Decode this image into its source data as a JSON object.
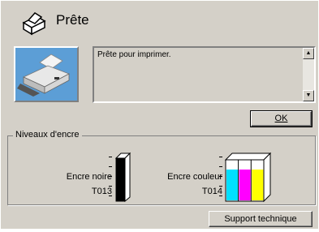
{
  "header": {
    "status_title": "Prête",
    "icon": "printer-status-icon"
  },
  "status": {
    "message": "Prête pour imprimer."
  },
  "buttons": {
    "ok_label": "OK",
    "support_label": "Support technique"
  },
  "ink": {
    "group_title": "Niveaux d'encre",
    "black": {
      "name": "Encre noire",
      "model": "T013",
      "color": "#000000"
    },
    "color": {
      "name": "Encre couleur",
      "model": "T014",
      "colors": [
        "#00e0ff",
        "#ff00ff",
        "#ffff00"
      ]
    }
  },
  "colors": {
    "window_bg": "#d4d0c8",
    "printer_bg": "#5c9ed6"
  }
}
